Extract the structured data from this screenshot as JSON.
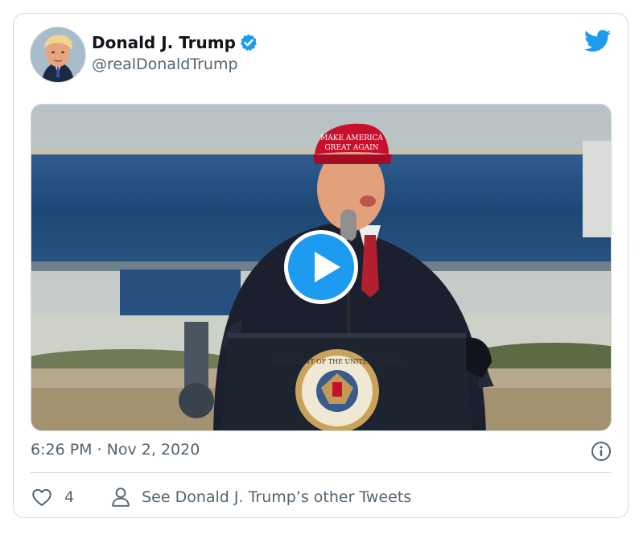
{
  "tweet": {
    "author_name": "Donald J. Trump",
    "handle": "@realDonaldTrump",
    "timestamp": "6:26 PM · Nov 2, 2020",
    "like_count": "4",
    "other_tweets_label": "See Donald J. Trump’s other Tweets"
  },
  "media": {
    "hat_text_line1": "MAKE AMERICA",
    "hat_text_line2": "GREAT AGAIN",
    "seal_text": "PRESIDENT OF THE UNITED STATES"
  },
  "colors": {
    "accent": "#1d9bf0",
    "text_primary": "#0f1419",
    "text_secondary": "#536471",
    "border": "#cfd9de"
  },
  "icons": {
    "verified": "verified-badge-icon",
    "brand": "twitter-bird-icon",
    "info": "info-icon",
    "like": "heart-icon",
    "profile": "person-icon",
    "play": "play-icon"
  }
}
